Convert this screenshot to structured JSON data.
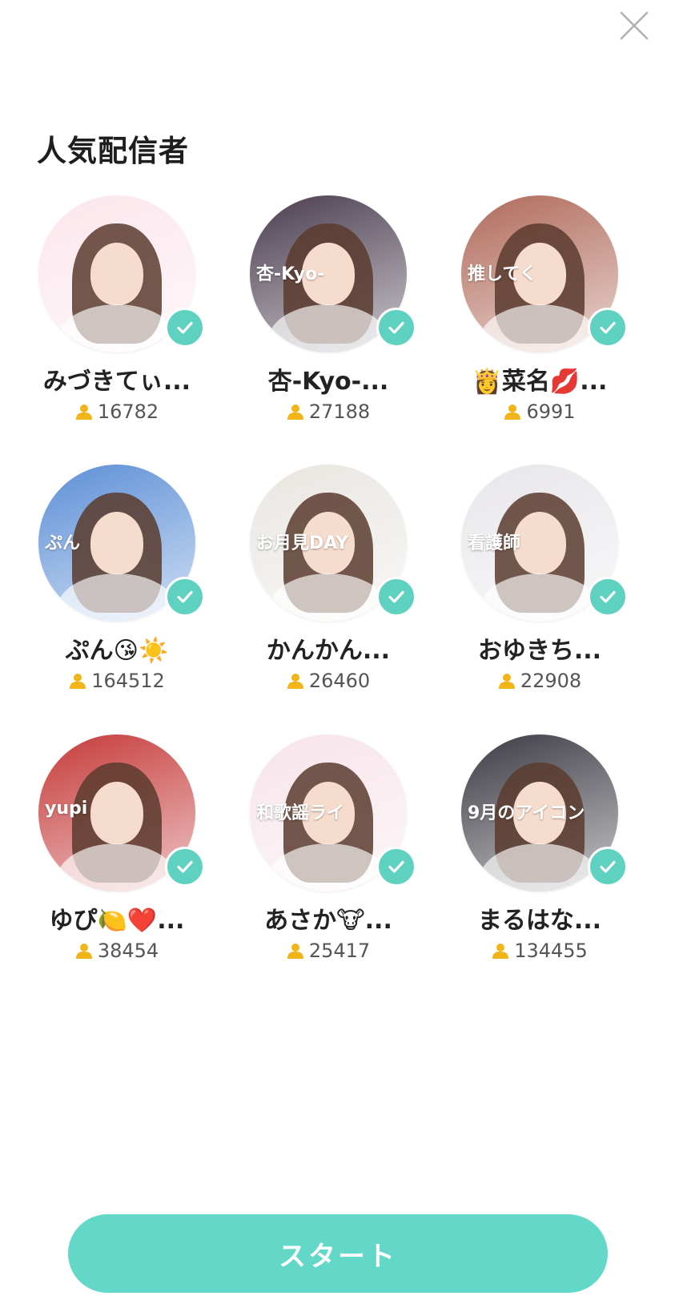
{
  "icons": {
    "close": "close-icon",
    "check": "check-icon",
    "follower": "user-icon"
  },
  "colors": {
    "accent": "#5fd1c1",
    "start_button": "#63d8c9",
    "follower_icon": "#f2b519"
  },
  "header": {
    "title": "人気配信者"
  },
  "streamers": [
    {
      "name": "みづきてぃ...",
      "followers": "16782",
      "avatar_bg": "#fbe6ec",
      "avatar_text": "",
      "selected": true
    },
    {
      "name": "杏-Kyo-...",
      "followers": "27188",
      "avatar_bg": "#4a3d4f",
      "avatar_text": "杏-Kyo-",
      "selected": true
    },
    {
      "name": "👸菜名💋...",
      "followers": "6991",
      "avatar_bg": "#b06a5a",
      "avatar_text": "推してく",
      "selected": true
    },
    {
      "name": "ぷん😘☀️",
      "followers": "164512",
      "avatar_bg": "#5c8fd6",
      "avatar_text": "ぷん",
      "selected": true
    },
    {
      "name": "かんかん...",
      "followers": "26460",
      "avatar_bg": "#e9e6e1",
      "avatar_text": "お月見DAY",
      "selected": true
    },
    {
      "name": "おゆきち...",
      "followers": "22908",
      "avatar_bg": "#e8e6ea",
      "avatar_text": "看護師",
      "selected": true
    },
    {
      "name": "ゆぴ🍋❤️...",
      "followers": "38454",
      "avatar_bg": "#c63a3a",
      "avatar_text": "yupi",
      "selected": true
    },
    {
      "name": "あさか🐮...",
      "followers": "25417",
      "avatar_bg": "#f7e4ea",
      "avatar_text": "和歌謡ライ",
      "selected": true
    },
    {
      "name": "まるはな...",
      "followers": "134455",
      "avatar_bg": "#3c3b44",
      "avatar_text": "9月のアイコン",
      "selected": true
    }
  ],
  "footer": {
    "start_label": "スタート"
  }
}
